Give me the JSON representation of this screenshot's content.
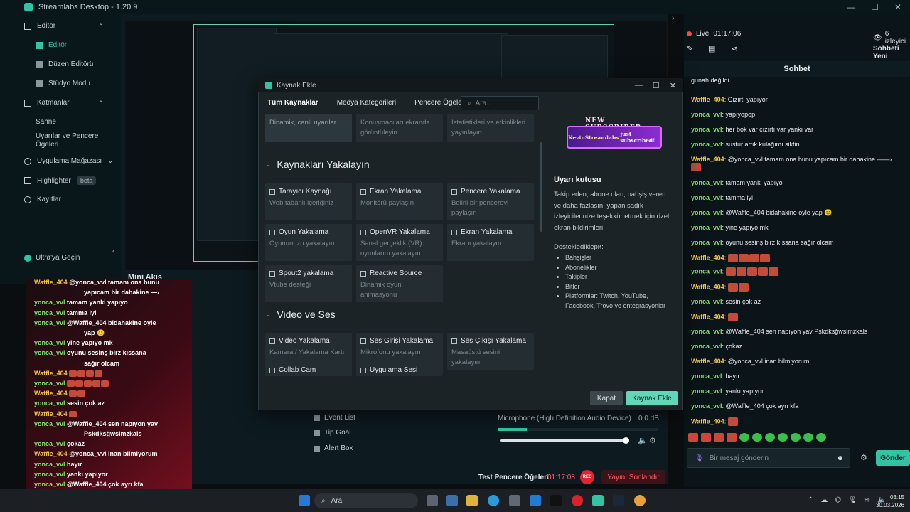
{
  "window": {
    "title": "Streamlabs Desktop - 1.20.9",
    "controls": [
      "—",
      "☐",
      "✕"
    ]
  },
  "nav": {
    "editor_group": "Editör",
    "editor": "Editör",
    "layout_editor": "Düzen Editörü",
    "studio_mode": "Stüdyo Modu",
    "layers_group": "Katmanlar",
    "scene": "Sahne",
    "alerts_windows": "Uyarılar ve Pencere Ögeleri",
    "app_store": "Uygulama Mağazası",
    "highlighter": "Highlighter",
    "beta": "beta",
    "recordings": "Kayıtlar",
    "ultra": "Ultra'ya Geçin"
  },
  "mini_stream": "Mini Akış",
  "bottom": {
    "event_list": "Event List",
    "tip_goal": "Tip Goal",
    "alert_box": "Alert Box",
    "mic_label": "Microphone (High Definition Audio Device)",
    "mic_db": "0.0 dB",
    "mic_level": 0.18,
    "mic_volume": 0.98
  },
  "status": {
    "test_label": "Test Pencere Öğeleri",
    "timer": "01:17:08",
    "rec": "REC",
    "end_stream": "Yayını Sonlandır"
  },
  "live": {
    "label": "Live",
    "time": "01:17:06",
    "viewers": "6 izleyici",
    "chat_new": "Sohbeti Yeni",
    "chat_title": "Sohbet"
  },
  "chat": [
    {
      "name": "",
      "text": "gunah değildi"
    },
    {
      "name": "Waffle_404",
      "text": "Cızırtı yapıyor"
    },
    {
      "name": "yonca_vvl",
      "text": "yapıyopop"
    },
    {
      "name": "yonca_vvl",
      "text": "her bok var cızırtı var yankı var"
    },
    {
      "name": "yonca_vvl",
      "text": "sustur artık kulağımı siktin"
    },
    {
      "name": "Waffle_404",
      "text": "@yonca_vvl tamam ona bunu yapıcam bir dahakine ——›"
    },
    {
      "name": "yonca_vvl",
      "text": "tamam yanki yapıyo"
    },
    {
      "name": "yonca_vvl",
      "text": "tamma iyi"
    },
    {
      "name": "yonca_vvl",
      "text": "@Waffle_404 bidahakine oyle yap 😊"
    },
    {
      "name": "yonca_vvl",
      "text": "yine yapıyo mk"
    },
    {
      "name": "yonca_vvl",
      "text": "oyunu sesinş birz kıssana sağır olcam"
    },
    {
      "name": "Waffle_404",
      "text": ""
    },
    {
      "name": "yonca_vvl",
      "text": ""
    },
    {
      "name": "Waffle_404",
      "text": ""
    },
    {
      "name": "yonca_vvl",
      "text": "sesin çok az"
    },
    {
      "name": "Waffle_404",
      "text": ""
    },
    {
      "name": "yonca_vvl",
      "text": "@Waffle_404 sen napıyon yav Pskdksğwslmzkals"
    },
    {
      "name": "yonca_vvl",
      "text": "çokaz"
    },
    {
      "name": "Waffle_404",
      "text": "@yonca_vvl inan bilmiyorum"
    },
    {
      "name": "yonca_vvl",
      "text": "hayır"
    },
    {
      "name": "yonca_vvl",
      "text": "yankı yapıyor"
    },
    {
      "name": "yonca_vvl",
      "text": "@Waffle_404 çok ayrı kfa"
    },
    {
      "name": "Waffle_404",
      "text": ""
    }
  ],
  "overlay_chat": [
    {
      "name": "Waffle_404",
      "text": "@yonca_vvl tamam ona bunu"
    },
    {
      "name": "",
      "text": "yapıcam bir dahakine —›"
    },
    {
      "name": "yonca_vvl",
      "text": "tamam yanki yapıyo"
    },
    {
      "name": "yonca_vvl",
      "text": "tamma iyi"
    },
    {
      "name": "yonca_vvl",
      "text": "@Waffle_404 bidahakine oyle"
    },
    {
      "name": "",
      "text": "yap 😊"
    },
    {
      "name": "yonca_vvl",
      "text": "yine yapıyo mk"
    },
    {
      "name": "yonca_vvl",
      "text": "oyunu sesinş birz kıssana"
    },
    {
      "name": "",
      "text": "sağır olcam"
    },
    {
      "name": "Waffle_404",
      "text": ""
    },
    {
      "name": "yonca_vvl",
      "text": ""
    },
    {
      "name": "Waffle_404",
      "text": ""
    },
    {
      "name": "yonca_vvl",
      "text": "sesin çok az"
    },
    {
      "name": "Waffle_404",
      "text": ""
    },
    {
      "name": "yonca_vvl",
      "text": "@Waffle_404 sen napıyon yav"
    },
    {
      "name": "",
      "text": "Pskdksğwslmzkals"
    },
    {
      "name": "yonca_vvl",
      "text": "çokaz"
    },
    {
      "name": "Waffle_404",
      "text": "@yonca_vvl inan bilmiyorum"
    },
    {
      "name": "yonca_vvl",
      "text": "hayır"
    },
    {
      "name": "yonca_vvl",
      "text": "yankı yapıyor"
    },
    {
      "name": "yonca_vvl",
      "text": "@Waffle_404 çok ayrı kfa"
    },
    {
      "name": "Waffle_404",
      "text": ""
    }
  ],
  "chat_input": {
    "placeholder": "Bir mesaj gönderin",
    "send": "Gönder"
  },
  "modal": {
    "title": "Kaynak Ekle",
    "tabs": [
      "Tüm Kaynaklar",
      "Medya Kategorileri",
      "Pencere Ögeleri"
    ],
    "search_placeholder": "Ara...",
    "top_cards": [
      {
        "desc": "Dinamik, canlı uyarılar"
      },
      {
        "desc": "Konuşmacıları ekranda görüntüleyin"
      },
      {
        "desc": "İstatistikleri ve etkinlikleri yayınlayın"
      }
    ],
    "section_capture": "Kaynakları Yakalayın",
    "capture_cards": [
      {
        "title": "Tarayıcı Kaynağı",
        "desc": "Web tabanlı içeriğiniz"
      },
      {
        "title": "Ekran Yakalama",
        "desc": "Monitörü paylaşın"
      },
      {
        "title": "Pencere Yakalama",
        "desc": "Belirli bir pencereyi paylaşın"
      },
      {
        "title": "Oyun Yakalama",
        "desc": "Oyununuzu yakalayın"
      },
      {
        "title": "OpenVR Yakalama",
        "desc": "Sanal gerçeklik (VR) oyunlarını yakalayın"
      },
      {
        "title": "Ekran Yakalama",
        "desc": "Ekranı yakalayın"
      },
      {
        "title": "Spout2 yakalama",
        "desc": "Vtube desteği"
      },
      {
        "title": "Reactive Source",
        "desc": "Dinamik oyun animasyonu"
      }
    ],
    "section_av": "Video ve Ses",
    "av_cards": [
      {
        "title": "Video Yakalama",
        "desc": "Kamera / Yakalama Kartı"
      },
      {
        "title": "Ses Girişi Yakalama",
        "desc": "Mikrofonu yakalayın"
      },
      {
        "title": "Ses Çıkışı Yakalama",
        "desc": "Masaüstü sesini yakalayın"
      },
      {
        "title": "Collab Cam",
        "desc": ""
      },
      {
        "title": "Uygulama Sesi",
        "desc": ""
      }
    ],
    "banner_new": "NEW SUBSCRIBER",
    "banner_name": "KevinStreamlabs",
    "banner_text": "just subscribed!",
    "pane_title": "Uyarı kutusu",
    "pane_desc": "Takip eden, abone olan, bahşiş veren ve daha fazlasını yapan sadık izleyicilerinize teşekkür etmek için özel ekran bildirimleri.",
    "pane_supported": "Desteklediklери:",
    "pane_list": [
      "Bahşişler",
      "Abonelikler",
      "Takipler",
      "Bitler",
      "Platformlar: Twitch, YouTube, Facebook, Trovo ve entegrasyonlar"
    ],
    "close": "Kapat",
    "add": "Kaynak Ekle"
  },
  "taskbar": {
    "search": "Ara",
    "time": "03:15",
    "date": "30.03.2026"
  },
  "colors": {
    "accent": "#31c3a2",
    "live": "#ff4545",
    "waffle": "#f0c44a",
    "yonca": "#7fe36b"
  }
}
